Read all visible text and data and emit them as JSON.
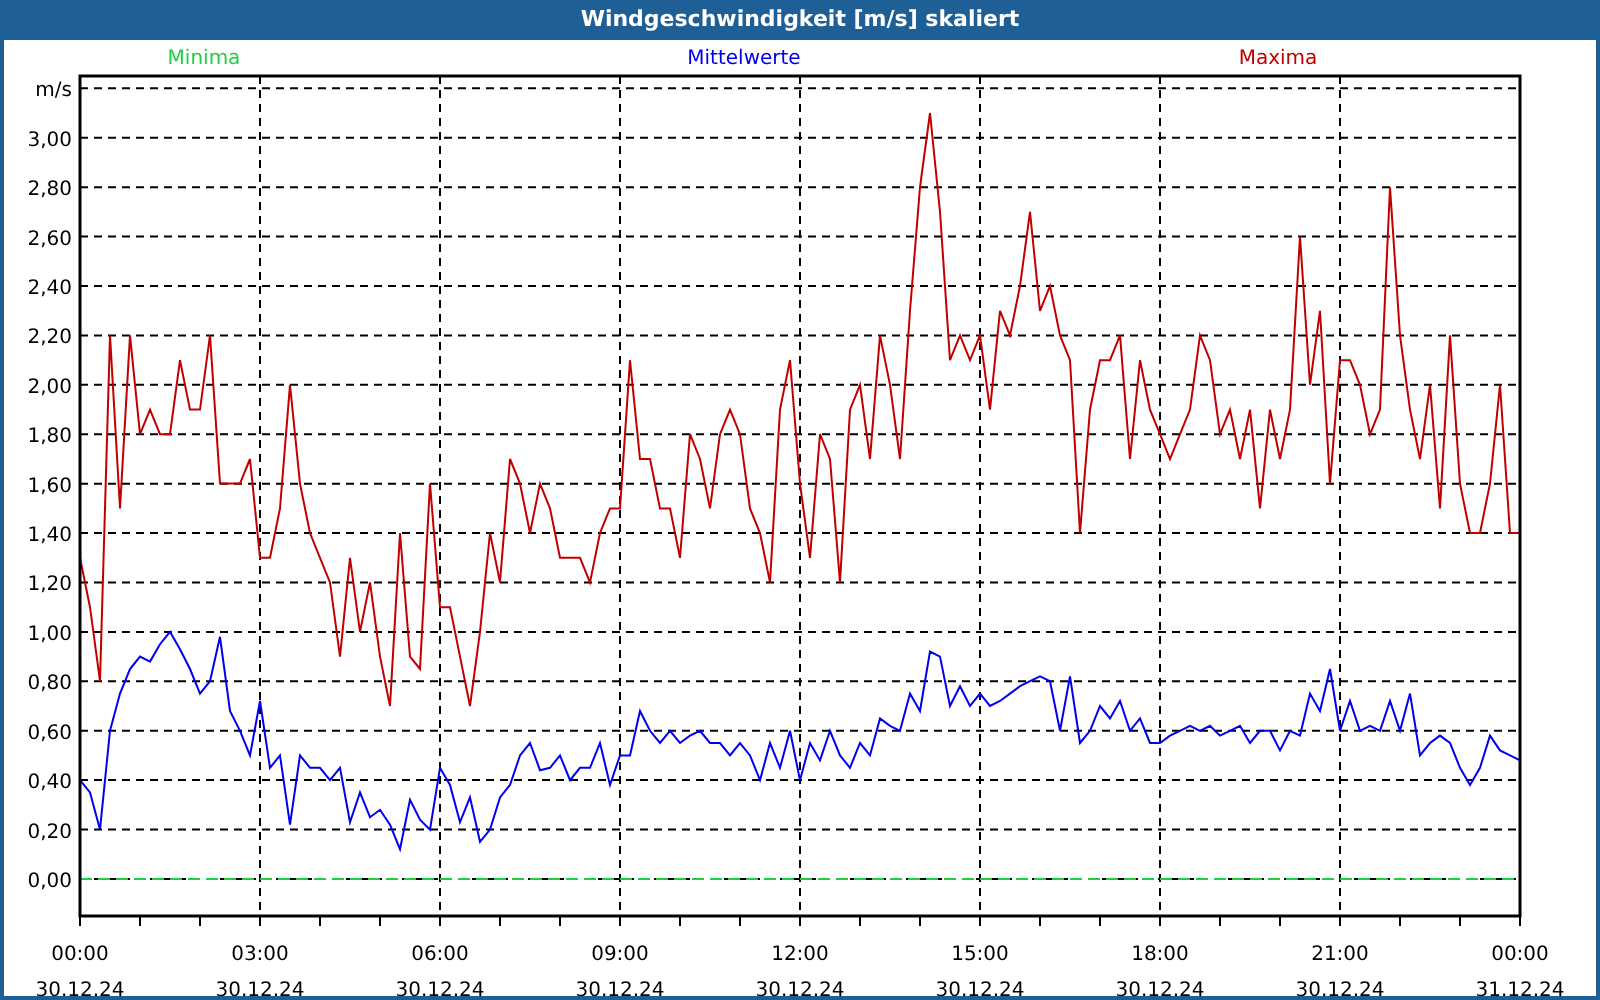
{
  "window": {
    "title": "Windgeschwindigkeit [m/s] skaliert"
  },
  "chart": {
    "chart_data": {
      "type": "line",
      "grid": true,
      "ylim": [
        -0.15,
        3.25
      ],
      "categories": [
        "00:00\n30.12.24",
        null,
        null,
        null,
        null,
        null,
        null,
        null,
        null,
        null,
        null,
        null,
        null,
        null,
        null,
        null,
        null,
        null,
        "03:00\n30.12.24",
        null,
        null,
        null,
        null,
        null,
        null,
        null,
        null,
        null,
        null,
        null,
        null,
        null,
        null,
        null,
        null,
        null,
        "06:00\n30.12.24",
        null,
        null,
        null,
        null,
        null,
        null,
        null,
        null,
        null,
        null,
        null,
        null,
        null,
        null,
        null,
        null,
        null,
        "09:00\n30.12.24",
        null,
        null,
        null,
        null,
        null,
        null,
        null,
        null,
        null,
        null,
        null,
        null,
        null,
        null,
        null,
        null,
        null,
        "12:00\n30.12.24",
        null,
        null,
        null,
        null,
        null,
        null,
        null,
        null,
        null,
        null,
        null,
        null,
        null,
        null,
        null,
        null,
        null,
        "15:00\n30.12.24",
        null,
        null,
        null,
        null,
        null,
        null,
        null,
        null,
        null,
        null,
        null,
        null,
        null,
        null,
        null,
        null,
        null,
        "18:00\n30.12.24",
        null,
        null,
        null,
        null,
        null,
        null,
        null,
        null,
        null,
        null,
        null,
        null,
        null,
        null,
        null,
        null,
        null,
        "21:00\n30.12.24",
        null,
        null,
        null,
        null,
        null,
        null,
        null,
        null,
        null,
        null,
        null,
        null,
        null,
        null,
        null,
        null,
        null,
        "00:00\n31.12.24"
      ],
      "yticks": [
        {
          "value": 0,
          "label": "0,00"
        },
        {
          "value": 0.2,
          "label": "0,20"
        },
        {
          "value": 0.4,
          "label": "0,40"
        },
        {
          "value": 0.6,
          "label": "0,60"
        },
        {
          "value": 0.8,
          "label": "0,80"
        },
        {
          "value": 1.0,
          "label": "1,00"
        },
        {
          "value": 1.2,
          "label": "1,20"
        },
        {
          "value": 1.4,
          "label": "1,40"
        },
        {
          "value": 1.6,
          "label": "1,60"
        },
        {
          "value": 1.8,
          "label": "1,80"
        },
        {
          "value": 2.0,
          "label": "2,00"
        },
        {
          "value": 2.2,
          "label": "2,20"
        },
        {
          "value": 2.4,
          "label": "2,40"
        },
        {
          "value": 2.6,
          "label": "2,60"
        },
        {
          "value": 2.8,
          "label": "2,80"
        },
        {
          "value": 3.0,
          "label": "3,00"
        },
        {
          "value": 3.2,
          "label": "m/s"
        }
      ],
      "series": [
        {
          "name": "Minima",
          "color": "#22cc44",
          "line_style": "dashed",
          "values": [
            0,
            0,
            0,
            0,
            0,
            0,
            0,
            0,
            0,
            0,
            0,
            0,
            0,
            0,
            0,
            0,
            0,
            0,
            0,
            0,
            0,
            0,
            0,
            0,
            0,
            0,
            0,
            0,
            0,
            0,
            0,
            0,
            0,
            0,
            0,
            0,
            0,
            0,
            0,
            0,
            0,
            0,
            0,
            0,
            0,
            0,
            0,
            0,
            0,
            0,
            0,
            0,
            0,
            0,
            0,
            0,
            0,
            0,
            0,
            0,
            0,
            0,
            0,
            0,
            0,
            0,
            0,
            0,
            0,
            0,
            0,
            0,
            0,
            0,
            0,
            0,
            0,
            0,
            0,
            0,
            0,
            0,
            0,
            0,
            0,
            0,
            0,
            0,
            0,
            0,
            0,
            0,
            0,
            0,
            0,
            0,
            0,
            0,
            0,
            0,
            0,
            0,
            0,
            0,
            0,
            0,
            0,
            0,
            0,
            0,
            0,
            0,
            0,
            0,
            0,
            0,
            0,
            0,
            0,
            0,
            0,
            0,
            0,
            0,
            0,
            0,
            0,
            0,
            0,
            0,
            0,
            0,
            0,
            0,
            0,
            0,
            0,
            0,
            0,
            0,
            0,
            0,
            0,
            0,
            0
          ]
        },
        {
          "name": "Mittelwerte",
          "color": "#0000ee",
          "line_style": "solid",
          "values": [
            0.4,
            0.35,
            0.2,
            0.6,
            0.75,
            0.85,
            0.9,
            0.88,
            0.95,
            1.0,
            0.93,
            0.85,
            0.75,
            0.8,
            0.98,
            0.68,
            0.6,
            0.5,
            0.72,
            0.45,
            0.5,
            0.22,
            0.5,
            0.45,
            0.45,
            0.4,
            0.45,
            0.23,
            0.35,
            0.25,
            0.28,
            0.22,
            0.12,
            0.32,
            0.24,
            0.2,
            0.45,
            0.38,
            0.23,
            0.33,
            0.15,
            0.2,
            0.33,
            0.38,
            0.5,
            0.55,
            0.44,
            0.45,
            0.5,
            0.4,
            0.45,
            0.45,
            0.55,
            0.38,
            0.5,
            0.5,
            0.68,
            0.6,
            0.55,
            0.6,
            0.55,
            0.58,
            0.6,
            0.55,
            0.55,
            0.5,
            0.55,
            0.5,
            0.4,
            0.55,
            0.45,
            0.6,
            0.4,
            0.55,
            0.48,
            0.6,
            0.5,
            0.45,
            0.55,
            0.5,
            0.65,
            0.62,
            0.6,
            0.75,
            0.68,
            0.92,
            0.9,
            0.7,
            0.78,
            0.7,
            0.75,
            0.7,
            0.72,
            0.75,
            0.78,
            0.8,
            0.82,
            0.8,
            0.6,
            0.82,
            0.55,
            0.6,
            0.7,
            0.65,
            0.72,
            0.6,
            0.65,
            0.55,
            0.55,
            0.58,
            0.6,
            0.62,
            0.6,
            0.62,
            0.58,
            0.6,
            0.62,
            0.55,
            0.6,
            0.6,
            0.52,
            0.6,
            0.58,
            0.75,
            0.68,
            0.85,
            0.6,
            0.72,
            0.6,
            0.62,
            0.6,
            0.72,
            0.6,
            0.75,
            0.5,
            0.55,
            0.58,
            0.55,
            0.45,
            0.38,
            0.45,
            0.58,
            0.52,
            0.5,
            0.48
          ]
        },
        {
          "name": "Maxima",
          "color": "#c00000",
          "line_style": "solid",
          "values": [
            1.3,
            1.1,
            0.8,
            2.2,
            1.5,
            2.2,
            1.8,
            1.9,
            1.8,
            1.8,
            2.1,
            1.9,
            1.9,
            2.2,
            1.6,
            1.6,
            1.6,
            1.7,
            1.3,
            1.3,
            1.5,
            2.0,
            1.6,
            1.4,
            1.3,
            1.2,
            0.9,
            1.3,
            1.0,
            1.2,
            0.9,
            0.7,
            1.4,
            0.9,
            0.85,
            1.6,
            1.1,
            1.1,
            0.9,
            0.7,
            1.0,
            1.4,
            1.2,
            1.7,
            1.6,
            1.4,
            1.6,
            1.5,
            1.3,
            1.3,
            1.3,
            1.2,
            1.4,
            1.5,
            1.5,
            2.1,
            1.7,
            1.7,
            1.5,
            1.5,
            1.3,
            1.8,
            1.7,
            1.5,
            1.8,
            1.9,
            1.8,
            1.5,
            1.4,
            1.2,
            1.9,
            2.1,
            1.6,
            1.3,
            1.8,
            1.7,
            1.2,
            1.9,
            2.0,
            1.7,
            2.2,
            2.0,
            1.7,
            2.3,
            2.8,
            3.1,
            2.7,
            2.1,
            2.2,
            2.1,
            2.2,
            1.9,
            2.3,
            2.2,
            2.4,
            2.7,
            2.3,
            2.4,
            2.2,
            2.1,
            1.4,
            1.9,
            2.1,
            2.1,
            2.2,
            1.7,
            2.1,
            1.9,
            1.8,
            1.7,
            1.8,
            1.9,
            2.2,
            2.1,
            1.8,
            1.9,
            1.7,
            1.9,
            1.5,
            1.9,
            1.7,
            1.9,
            2.6,
            2.0,
            2.3,
            1.6,
            2.1,
            2.1,
            2.0,
            1.8,
            1.9,
            2.8,
            2.2,
            1.9,
            1.7,
            2.0,
            1.5,
            2.2,
            1.6,
            1.4,
            1.4,
            1.6,
            2.0,
            1.4,
            1.4
          ]
        }
      ]
    }
  }
}
